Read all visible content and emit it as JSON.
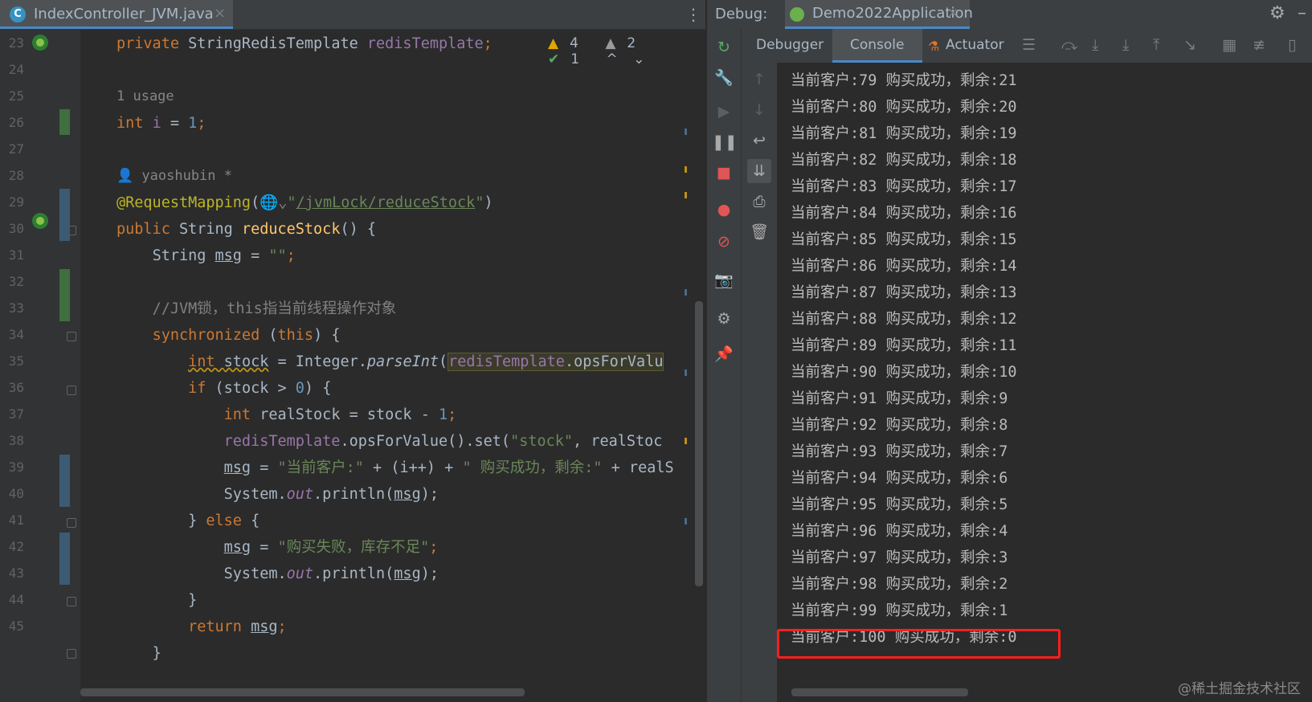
{
  "editor": {
    "file_tab": {
      "icon_letter": "C",
      "name": "IndexController_JVM.java",
      "close": "×"
    },
    "menu_glyph": "⋮",
    "inspection": {
      "warnings": "4",
      "weak_warnings": "2",
      "typos": "1",
      "up": "^",
      "down": "⌄"
    },
    "line_numbers": [
      "23",
      "24",
      "25",
      "26",
      "27",
      "28",
      "29",
      "30",
      "31",
      "32",
      "33",
      "34",
      "35",
      "36",
      "37",
      "38",
      "39",
      "40",
      "41",
      "42",
      "43",
      "44",
      "45"
    ],
    "hints": {
      "usage": "1 usage",
      "author": "yaoshubin *"
    },
    "code": {
      "l23": {
        "kw": "private ",
        "type": "StringRedisTemplate ",
        "field": "redisTemplate",
        "semi": ";"
      },
      "l25": {
        "kw": "int ",
        "field": "i",
        "eq": " = ",
        "num": "1",
        "semi": ";"
      },
      "l27": {
        "ann": "@RequestMapping",
        "open": "(",
        "globe": "🌐⌄",
        "q1": "\"",
        "path": "/jvmLock/reduceStock",
        "q2": "\"",
        "close": ")"
      },
      "l28": {
        "kw": "public ",
        "type": "String ",
        "fn": "reduceStock",
        "rest": "() {"
      },
      "l29": {
        "indent": "    ",
        "type": "String ",
        "var": "msg",
        "eq": " = ",
        "str": "\"\"",
        "semi": ";"
      },
      "l31": {
        "indent": "    ",
        "com": "//JVM锁，this指当前线程操作对象"
      },
      "l32": {
        "indent": "    ",
        "kw": "synchronized ",
        "open": "(",
        "kw2": "this",
        "close": ") {"
      },
      "l33": {
        "indent": "        ",
        "kw": "int ",
        "var": "stock",
        "eq": " = Integer.",
        "fn": "parseInt",
        "open": "(",
        "field": "redisTemplate",
        "rest": ".opsForValu"
      },
      "l34": {
        "indent": "        ",
        "kw": "if ",
        "rest1": "(stock > ",
        "num": "0",
        "rest2": ") {"
      },
      "l35": {
        "indent": "            ",
        "kw": "int ",
        "rest1": "realStock = stock - ",
        "num": "1",
        "semi": ";"
      },
      "l36": {
        "indent": "            ",
        "field": "redisTemplate",
        "rest1": ".opsForValue().set(",
        "str": "\"stock\"",
        "rest2": ", realStoc"
      },
      "l37": {
        "indent": "            ",
        "var": "msg",
        "rest1": " = ",
        "str1": "\"当前客户:\"",
        "rest2": " + (i++) + ",
        "str2": "\" 购买成功，剩余:\"",
        "rest3": " + realS"
      },
      "l38": {
        "indent": "            ",
        "rest1": "System.",
        "out": "out",
        "rest2": ".println(",
        "var": "msg",
        "rest3": ");"
      },
      "l39": {
        "indent": "        ",
        "rest1": "} ",
        "kw": "else",
        "rest2": " {"
      },
      "l40": {
        "indent": "            ",
        "var": "msg",
        "rest1": " = ",
        "str": "\"购买失败，库存不足\"",
        "semi": ";"
      },
      "l41": {
        "indent": "            ",
        "rest1": "System.",
        "out": "out",
        "rest2": ".println(",
        "var": "msg",
        "rest3": ");"
      },
      "l42": {
        "indent": "        ",
        "rest": "}"
      },
      "l43": {
        "indent": "        ",
        "kw": "return ",
        "var": "msg",
        "semi": ";"
      },
      "l44": {
        "indent": "    ",
        "rest": "}"
      }
    }
  },
  "debug": {
    "label": "Debug:",
    "app_tab": "Demo2022Application",
    "app_close": "×",
    "gear": "⚙",
    "minimize": "–",
    "tabs": {
      "debugger": "Debugger",
      "console": "Console",
      "actuator": "Actuator"
    },
    "console_lines": [
      "当前客户:79 购买成功，剩余:21",
      "当前客户:80 购买成功，剩余:20",
      "当前客户:81 购买成功，剩余:19",
      "当前客户:82 购买成功，剩余:18",
      "当前客户:83 购买成功，剩余:17",
      "当前客户:84 购买成功，剩余:16",
      "当前客户:85 购买成功，剩余:15",
      "当前客户:86 购买成功，剩余:14",
      "当前客户:87 购买成功，剩余:13",
      "当前客户:88 购买成功，剩余:12",
      "当前客户:89 购买成功，剩余:11",
      "当前客户:90 购买成功，剩余:10",
      "当前客户:91 购买成功，剩余:9",
      "当前客户:92 购买成功，剩余:8",
      "当前客户:93 购买成功，剩余:7",
      "当前客户:94 购买成功，剩余:6",
      "当前客户:95 购买成功，剩余:5",
      "当前客户:96 购买成功，剩余:4",
      "当前客户:97 购买成功，剩余:3",
      "当前客户:98 购买成功，剩余:2",
      "当前客户:99 购买成功，剩余:1",
      "当前客户:100 购买成功，剩余:0"
    ]
  },
  "watermark": "@稀土掘金技术社区",
  "colors": {
    "accent": "#4a88c7",
    "highlight_box": "#ff1e1e",
    "keyword": "#cc7832",
    "string": "#6a8759"
  }
}
